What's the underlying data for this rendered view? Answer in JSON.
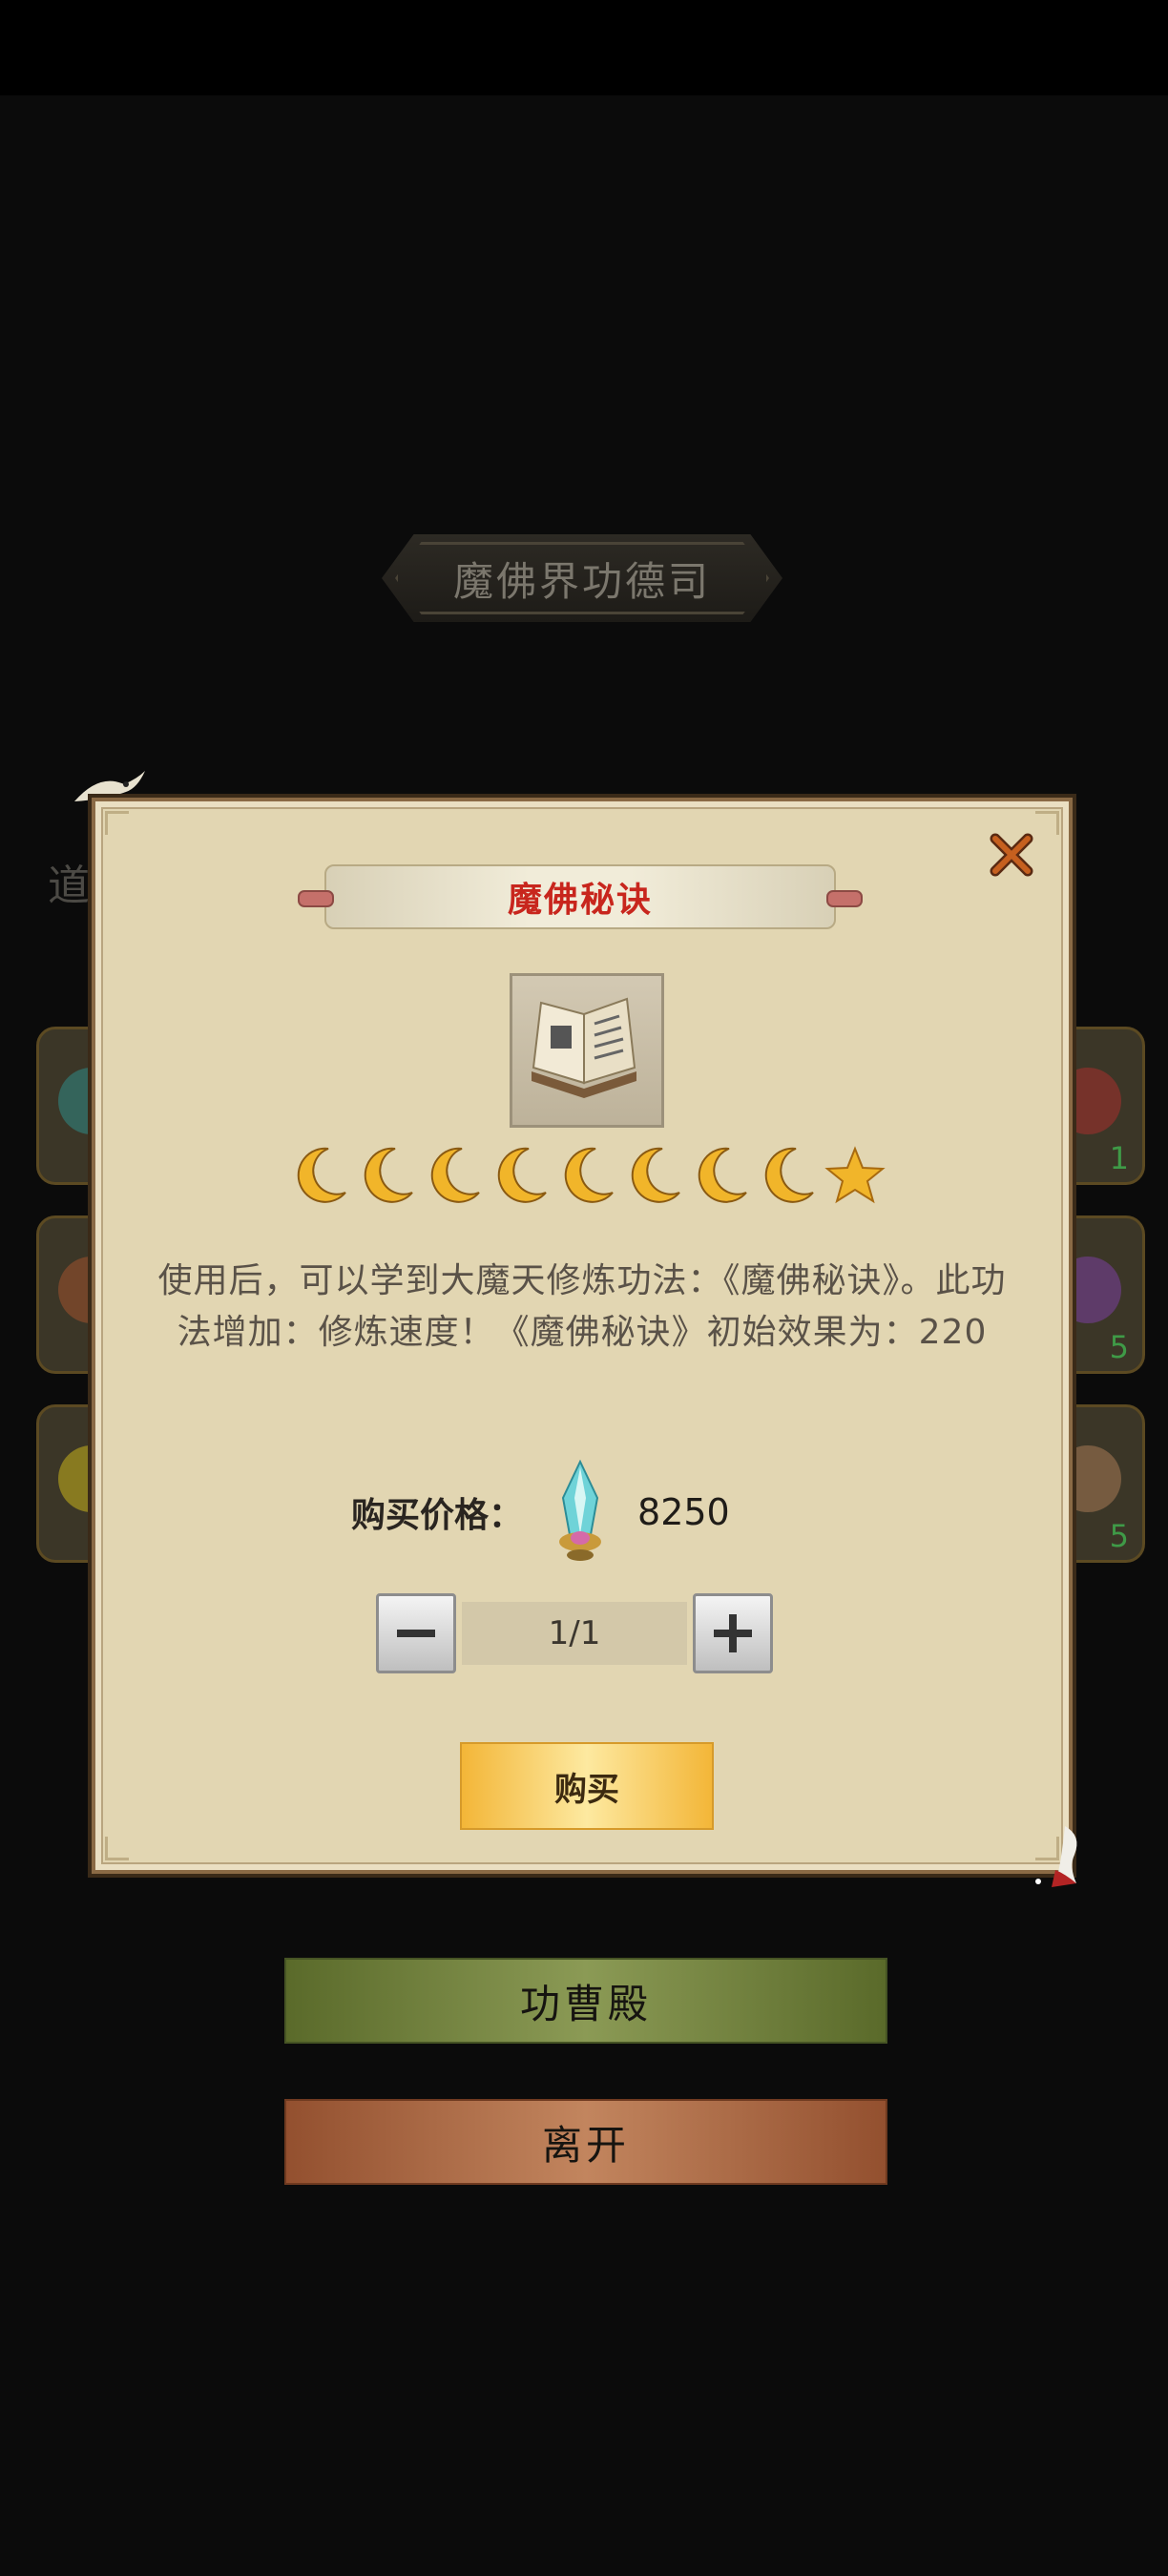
{
  "background": {
    "title": "魔佛界功德司",
    "side_text": "道",
    "right_slot_counts": [
      "1",
      "5",
      "5"
    ],
    "buttons": {
      "hall": "功曹殿",
      "leave": "离开"
    }
  },
  "dialog": {
    "title": "魔佛秘诀",
    "item_icon": "book-icon",
    "rating": {
      "moons": 8,
      "stars": 1
    },
    "description": "使用后，可以学到大魔天修炼功法：《魔佛秘诀》。此功法增加：修炼速度！《魔佛秘诀》初始效果为：220",
    "price_label": "购买价格：",
    "currency_icon": "crystal-gem-icon",
    "price_value": "8250",
    "quantity": "1/1",
    "buy_label": "购买"
  },
  "colors": {
    "dialog_bg": "#e2d6b2",
    "title_red": "#c8261d",
    "buy_gold": "#f3b638",
    "moon_gold": "#f1b52a"
  }
}
